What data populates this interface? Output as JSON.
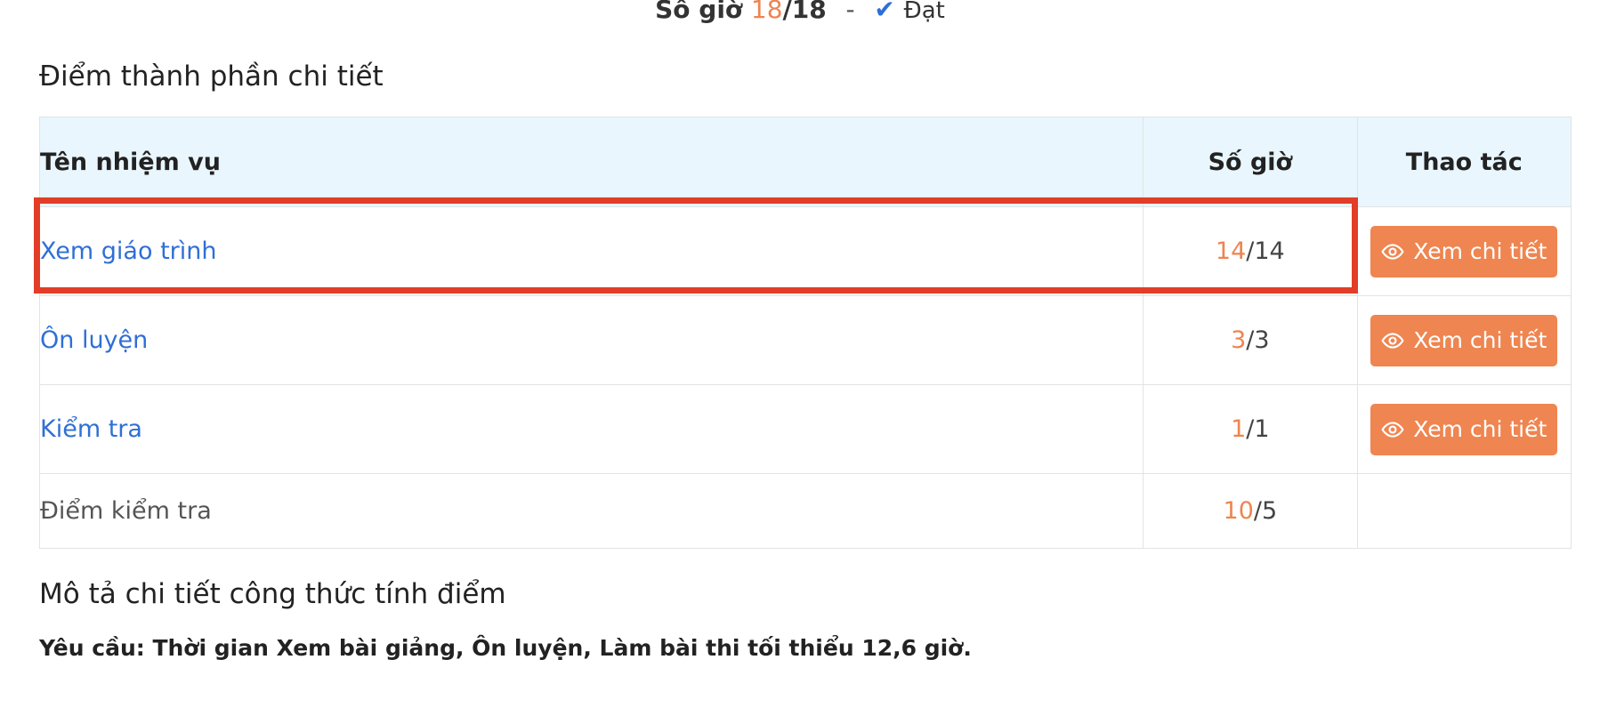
{
  "summary": {
    "label": "Số giờ",
    "earned": "18",
    "total": "/18",
    "separator": "-",
    "check": "✔",
    "status": "Đạt"
  },
  "detail": {
    "title": "Điểm thành phần chi tiết",
    "headers": {
      "name": "Tên nhiệm vụ",
      "hours": "Số giờ",
      "action": "Thao tác"
    },
    "rows": [
      {
        "name": "Xem giáo trình",
        "earned": "14",
        "total": "/14",
        "button": "Xem chi tiết"
      },
      {
        "name": "Ôn luyện",
        "earned": "3",
        "total": "/3",
        "button": "Xem chi tiết"
      },
      {
        "name": "Kiểm tra",
        "earned": "1",
        "total": "/1",
        "button": "Xem chi tiết"
      }
    ],
    "score_row": {
      "name": "Điểm kiểm tra",
      "earned": "10",
      "total": "/5"
    }
  },
  "formula": {
    "title": "Mô tả chi tiết công thức tính điểm",
    "requirement": "Yêu cầu: Thời gian Xem bài giảng, Ôn luyện, Làm bài thi tối thiểu 12,6 giờ."
  },
  "colors": {
    "accent": "#ee8450",
    "link": "#2f6fd6",
    "header_bg": "#e9f6fd",
    "highlight": "#e23d28"
  }
}
